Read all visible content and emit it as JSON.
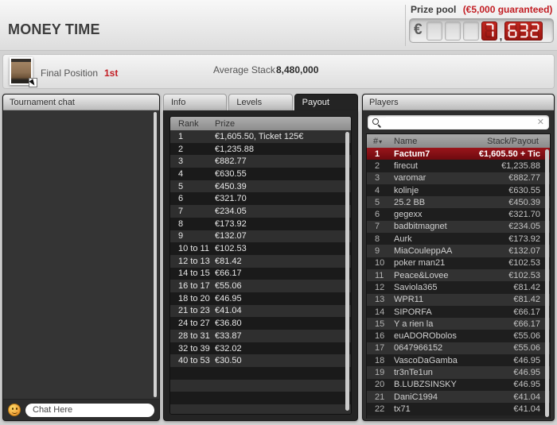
{
  "header": {
    "title": "MONEY TIME",
    "prize_pool_label": "Prize pool",
    "prize_pool_guarantee": "(€5,000 guaranteed)",
    "display": {
      "currency": "€",
      "empty_cells": 3,
      "digits_group1": "7",
      "comma": ",",
      "digits_group2": "632"
    }
  },
  "info_bar": {
    "final_position_label": "Final Position",
    "final_position_value": "1st",
    "average_stack_label": "Average Stack",
    "average_stack_value": "8,480,000"
  },
  "chat": {
    "title": "Tournament chat",
    "input_value": "Chat Here"
  },
  "tabs": [
    {
      "label": "Info",
      "active": false
    },
    {
      "label": "Levels",
      "active": false
    },
    {
      "label": "Payout",
      "active": true
    }
  ],
  "payout": {
    "columns": [
      "Rank",
      "Prize"
    ],
    "rows": [
      [
        "1",
        "€1,605.50, Ticket 125€"
      ],
      [
        "2",
        "€1,235.88"
      ],
      [
        "3",
        "€882.77"
      ],
      [
        "4",
        "€630.55"
      ],
      [
        "5",
        "€450.39"
      ],
      [
        "6",
        "€321.70"
      ],
      [
        "7",
        "€234.05"
      ],
      [
        "8",
        "€173.92"
      ],
      [
        "9",
        "€132.07"
      ],
      [
        "10 to 11",
        "€102.53"
      ],
      [
        "12 to 13",
        "€81.42"
      ],
      [
        "14 to 15",
        "€66.17"
      ],
      [
        "16 to 17",
        "€55.06"
      ],
      [
        "18 to 20",
        "€46.95"
      ],
      [
        "21 to 23",
        "€41.04"
      ],
      [
        "24 to 27",
        "€36.80"
      ],
      [
        "28 to 31",
        "€33.87"
      ],
      [
        "32 to 39",
        "€32.02"
      ],
      [
        "40 to 53",
        "€30.50"
      ]
    ],
    "filler_rows": 4
  },
  "players": {
    "title": "Players",
    "search_value": "",
    "clear_glyph": "✕",
    "columns": [
      "#",
      "Name",
      "Stack/Payout"
    ],
    "sort_indicator": "▾",
    "badge_glyph": "✱",
    "rows": [
      {
        "pos": "1",
        "name": "Factum7",
        "payout": "€1,605.50 + Tic",
        "highlight": true
      },
      {
        "pos": "2",
        "name": "firecut",
        "payout": "€1,235.88"
      },
      {
        "pos": "3",
        "name": "varomar",
        "payout": "€882.77"
      },
      {
        "pos": "4",
        "name": "kolinje",
        "payout": "€630.55"
      },
      {
        "pos": "5",
        "name": "25.2 BB",
        "payout": "€450.39"
      },
      {
        "pos": "6",
        "name": "gegexx",
        "payout": "€321.70"
      },
      {
        "pos": "7",
        "name": "badbitmagnet",
        "payout": "€234.05"
      },
      {
        "pos": "8",
        "name": "Aurk",
        "payout": "€173.92"
      },
      {
        "pos": "9",
        "name": "MiaCouleppAA",
        "payout": "€132.07"
      },
      {
        "pos": "10",
        "name": "poker man21",
        "payout": "€102.53"
      },
      {
        "pos": "11",
        "name": "Peace&Lovee",
        "payout": "€102.53"
      },
      {
        "pos": "12",
        "name": "Saviola365",
        "payout": "€81.42"
      },
      {
        "pos": "13",
        "name": "WPR11",
        "payout": "€81.42"
      },
      {
        "pos": "14",
        "name": "SIPORFA",
        "payout": "€66.17"
      },
      {
        "pos": "15",
        "name": "Y a rien la",
        "payout": "€66.17"
      },
      {
        "pos": "16",
        "name": "euADORObolos",
        "payout": "€55.06"
      },
      {
        "pos": "17",
        "name": "0647966152",
        "payout": "€55.06"
      },
      {
        "pos": "18",
        "name": "VascoDaGamba",
        "payout": "€46.95"
      },
      {
        "pos": "19",
        "name": "tr3nTe1un",
        "payout": "€46.95"
      },
      {
        "pos": "20",
        "name": "B.LUBZSINSKY",
        "payout": "€46.95",
        "badge": true
      },
      {
        "pos": "21",
        "name": "DaniC1994",
        "payout": "€41.04"
      },
      {
        "pos": "22",
        "name": "tx71",
        "payout": "€41.04"
      }
    ]
  }
}
